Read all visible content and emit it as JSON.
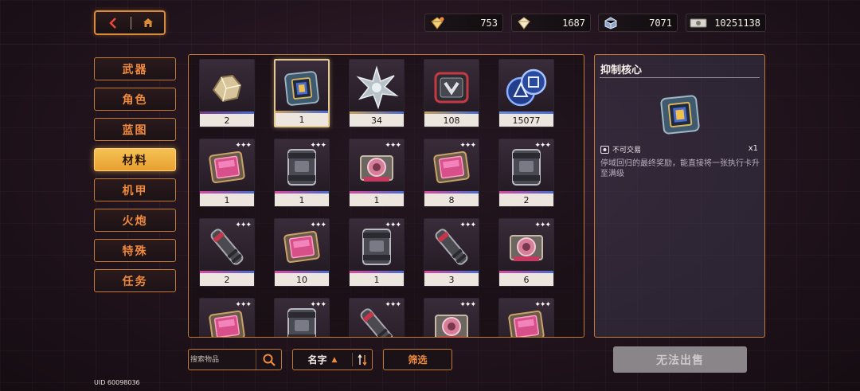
{
  "currencies": [
    {
      "icon": "gold-crystal-icon",
      "value": "753"
    },
    {
      "icon": "silver-crystal-icon",
      "value": "1687"
    },
    {
      "icon": "blue-cube-icon",
      "value": "7071"
    },
    {
      "icon": "cash-icon",
      "value": "10251138"
    }
  ],
  "categories": [
    {
      "label": "武器"
    },
    {
      "label": "角色"
    },
    {
      "label": "蓝图"
    },
    {
      "label": "材料",
      "active": true
    },
    {
      "label": "机甲"
    },
    {
      "label": "火炮"
    },
    {
      "label": "特殊"
    },
    {
      "label": "任务"
    }
  ],
  "items": [
    {
      "count": "2",
      "icon": "gold-ore-icon",
      "bar": "#7a3d8a"
    },
    {
      "count": "1",
      "icon": "suppression-core-icon",
      "bar": "#c8a060",
      "selected": true
    },
    {
      "count": "34",
      "icon": "crystal-star-icon",
      "bar": "#c8a060"
    },
    {
      "count": "108",
      "icon": "emblem-icon",
      "bar": "#c8a060"
    },
    {
      "count": "15077",
      "icon": "blue-dice-icon",
      "bar": "#6b8ed8"
    },
    {
      "count": "1",
      "icon": "pink-core-icon",
      "bar": "#d84aa0"
    },
    {
      "count": "1",
      "icon": "steel-canister-icon",
      "bar": "#d84aa0"
    },
    {
      "count": "1",
      "icon": "pink-reactor-icon",
      "bar": "#d84aa0"
    },
    {
      "count": "8",
      "icon": "pink-core-icon",
      "bar": "#d84aa0"
    },
    {
      "count": "2",
      "icon": "steel-canister-icon",
      "bar": "#d84aa0"
    },
    {
      "count": "2",
      "icon": "cylinder-part-icon",
      "bar": "#d84aa0"
    },
    {
      "count": "10",
      "icon": "pink-core-icon",
      "bar": "#d84aa0"
    },
    {
      "count": "1",
      "icon": "steel-canister-icon",
      "bar": "#d84aa0"
    },
    {
      "count": "3",
      "icon": "cylinder-part-icon",
      "bar": "#d84aa0"
    },
    {
      "count": "6",
      "icon": "pink-reactor-icon",
      "bar": "#d84aa0"
    },
    {
      "count": "",
      "icon": "pink-core-icon",
      "bar": "#d84aa0"
    },
    {
      "count": "",
      "icon": "steel-canister-icon",
      "bar": "#d84aa0"
    },
    {
      "count": "",
      "icon": "cylinder-part-icon",
      "bar": "#d84aa0"
    },
    {
      "count": "",
      "icon": "pink-reactor-icon",
      "bar": "#d84aa0"
    },
    {
      "count": "",
      "icon": "pink-core-icon",
      "bar": "#d84aa0"
    }
  ],
  "detail": {
    "title": "抑制核心",
    "trade_status": "不可交易",
    "quantity": "x1",
    "description": "停域回归的最终奖励，能直接将一张执行卡升至满级"
  },
  "search": {
    "placeholder": "搜索物品"
  },
  "sort": {
    "label": "名字"
  },
  "filter": {
    "label": "筛选"
  },
  "sell": {
    "label": "无法出售"
  },
  "uid": "UID 60098036",
  "colors": {
    "accent": "#f08a3c",
    "border": "#c27a33",
    "active": "#f5c255"
  }
}
